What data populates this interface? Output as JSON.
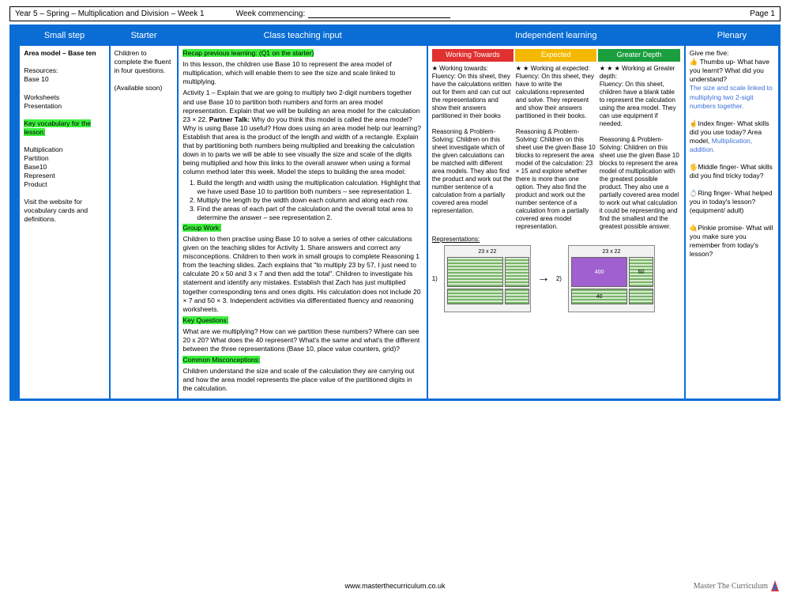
{
  "header": {
    "title": "Year 5 – Spring – Multiplication and Division – Week 1",
    "week_commencing_label": "Week commencing:",
    "page": "Page 1"
  },
  "columns": {
    "smallstep": "Small step",
    "starter": "Starter",
    "teaching": "Class teaching input",
    "independent": "Independent learning",
    "plenary": "Plenary"
  },
  "il_levels": {
    "wt": "Working Towards",
    "exp": "Expected",
    "gd": "Greater Depth"
  },
  "smallstep": {
    "title": "Area model – Base ten",
    "resources_label": "Resources:",
    "resources": "Base 10\n\nWorksheets\nPresentation",
    "vocab_label": "Key vocabulary for the lesson:",
    "vocab": "Multiplication\nPartition\nBase10\nRepresent\nProduct",
    "visit": "Visit the website for vocabulary cards and definitions."
  },
  "starter": {
    "text": "Children to complete the fluent in four questions.",
    "avail": "(Available soon)"
  },
  "teaching": {
    "recap_label": "Recap previous learning: (Q1 on the starter)",
    "recap_body": "In this lesson, the children use Base 10 to represent the area model of multiplication, which will enable them to see the size and scale linked to multiplying.",
    "activity1": "Activity 1 – Explain that we are going to multiply two 2-digit numbers together and use Base 10 to partition both numbers and form an area model representation. Explain that we will be building an area model for the calculation 23 × 22. ",
    "partner_label": "Partner Talk:",
    "partner_body": "Why do you think this model is called the area model? Why is using Base 10 useful? How does using an area model help our learning? Establish that area is the product of the length and width of a rectangle. Explain that by partitioning both numbers being multiplied and breaking the calculation down in to parts we will be able to see visually the size and scale of the digits being multiplied and how this links to the overall answer when using a formal column method later this week. Model the steps to building the area model:",
    "steps": [
      "Build the length and width using the multiplication calculation. Highlight that we have used Base 10 to partition both numbers – see representation 1.",
      "Multiply the length by the width down each column and along each row.",
      "Find the areas of each part of the calculation and the overall total area to determine the answer – see representation 2."
    ],
    "group_label": "Group Work:",
    "group_body": "Children to then practise using Base 10 to solve a series of other calculations given on the teaching slides for Activity 1. Share answers and correct any misconceptions. Children to then work in small groups to complete Reasoning 1 from the teaching slides. Zach explains that \"to multiply 23 by 57, I just need to calculate 20 x 50 and 3 x 7 and then add the total\". Children to investigate his statement and identify any mistakes. Establish that Zach has just multiplied together corresponding tens and ones digits. His calculation does not include 20 × 7 and 50 × 3. Independent activities via differentiated fluency and reasoning worksheets.",
    "kq_label": "Key Questions:",
    "kq_body": "What are we multiplying? How can we partition these numbers? Where can see 20 x 20? What does the 40 represent? What's the same and what's the different between the three representations (Base 10, place value counters, grid)?",
    "cm_label": "Common Misconceptions:",
    "cm_body": "Children understand the size and scale of the calculation they are carrying out and how the area model represents the place value of the partitioned digits in the calculation."
  },
  "il": {
    "wt": "★ Working towards:\nFluency: On this sheet, they have the calculations written out for them and can cut out the representations and show their answers partitioned in their books\n\nReasoning & Problem-Solving: Children on this sheet investigate which of the given calculations can be matched with different area models. They also find the product and work out the number sentence of a calculation from a partially covered area model representation.",
    "exp": "★ ★ Working at expected:\nFluency: On this sheet, they have to write the calculations represented and solve. They represent and show their answers partitioned in their books.\n\nReasoning & Problem-Solving: Children on this sheet use the given Base 10 blocks to represent the area model of the calculation: 23 × 15 and explore whether there is more than one option. They also find the product and work out the number sentence of a calculation from a partially covered area model representation.",
    "gd": "★ ★ ★ Working at Greater depth:\nFluency: On this sheet, children have a blank table to represent the calculation using the area model. They can use equipment if needed.\n\nReasoning & Problem-Solving: Children on this sheet use the given Base 10 blocks to represent the area model of multiplication with the greatest possible product. They also use a partially covered area model to work out what calculation it could be representing and find the smallest and the greatest possible answer.",
    "reps_label": "Representations:",
    "rep1_num": "1)",
    "rep2_num": "2)",
    "rep_caption": "23 x 22",
    "rep_400": "400",
    "rep_60": "60",
    "rep_40": "40"
  },
  "plenary": {
    "intro": "Give me five:",
    "thumbs": "👍 Thumbs up- What have you learnt? What did you understand?",
    "thumbs_blue": "The size and scale linked to multiplying two 2-sigit numbers together.",
    "index": "☝Index finger- What skills did you use today? Area model,",
    "index_blue": "Multiplication, addition.",
    "middle": "🖐Middle finger- What skills did you find tricky today?",
    "ring": "💍Ring finger- What helped you in today's lesson? (equipment/ adult)",
    "pinkie": "🤙Pinkie promise- What will you make sure you remember from today's lesson?"
  },
  "footer": {
    "url": "www.masterthecurriculum.co.uk",
    "brand": "Master The Curriculum"
  }
}
